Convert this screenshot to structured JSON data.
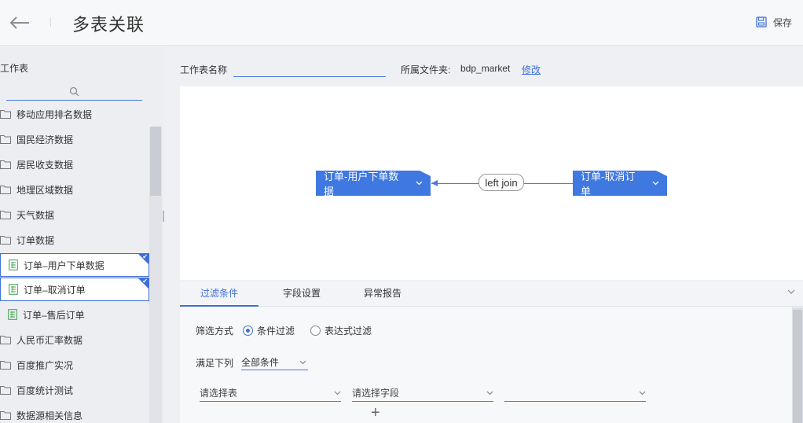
{
  "header": {
    "title": "多表关联",
    "save_label": "保存"
  },
  "sidebar": {
    "title": "工作表",
    "search_placeholder": "",
    "items": [
      {
        "type": "folder",
        "label": "移动应用排名数据"
      },
      {
        "type": "folder",
        "label": "国民经济数据"
      },
      {
        "type": "folder",
        "label": "居民收支数据"
      },
      {
        "type": "folder",
        "label": "地理区域数据"
      },
      {
        "type": "folder",
        "label": "天气数据"
      },
      {
        "type": "folder",
        "label": "订单数据"
      },
      {
        "type": "table",
        "label": "订单–用户下单数据",
        "selected": true
      },
      {
        "type": "table",
        "label": "订单–取消订单",
        "selected": true
      },
      {
        "type": "table",
        "label": "订单–售后订单",
        "selected": false
      },
      {
        "type": "folder",
        "label": "人民币汇率数据"
      },
      {
        "type": "folder",
        "label": "百度推广实况"
      },
      {
        "type": "folder",
        "label": "百度统计测试"
      },
      {
        "type": "folder",
        "label": "数据源相关信息"
      }
    ]
  },
  "form": {
    "name_label": "工作表名称",
    "name_value": "",
    "folder_label": "所属文件夹:",
    "folder_value": "bdp_market",
    "folder_edit": "修改"
  },
  "join": {
    "left_table": "订单-用户下单数据",
    "right_table": "订单-取消订单",
    "type": "left join"
  },
  "panel": {
    "tabs": [
      {
        "label": "过滤条件",
        "active": true
      },
      {
        "label": "字段设置",
        "active": false
      },
      {
        "label": "异常报告",
        "active": false
      }
    ],
    "filter_mode_label": "筛选方式",
    "filter_options": [
      {
        "label": "条件过滤",
        "checked": true
      },
      {
        "label": "表达式过滤",
        "checked": false
      }
    ],
    "meet_label": "满足下列",
    "meet_value": "全部条件",
    "table_select": "请选择表",
    "field_select": "请选择字段",
    "value_select": "",
    "add_label": "+"
  },
  "colors": {
    "accent": "#3f78e0",
    "link": "#3f6fd8"
  }
}
